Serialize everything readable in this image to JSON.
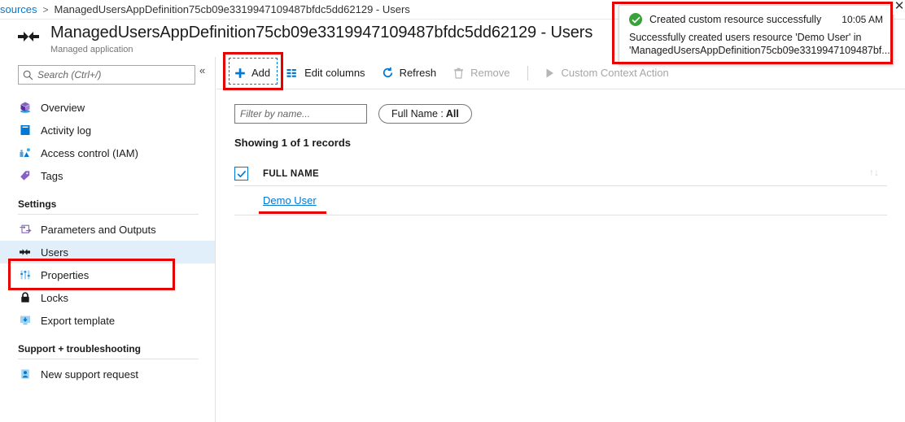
{
  "breadcrumb": {
    "root_label": "sources",
    "separator": ">",
    "current": "ManagedUsersAppDefinition75cb09e3319947109487bfdc5dd62129 - Users"
  },
  "header": {
    "title": "ManagedUsersAppDefinition75cb09e3319947109487bfdc5dd62129 - Users",
    "subtitle": "Managed application",
    "icon": "managed-application-icon"
  },
  "sidebar": {
    "search": {
      "placeholder": "Search (Ctrl+/)",
      "value": "",
      "icon": "search-icon"
    },
    "collapse": {
      "label": "«",
      "icon": "chevron-double-left-icon"
    },
    "items": [
      {
        "label": "Overview",
        "icon": "overview-icon",
        "selected": false
      },
      {
        "label": "Activity log",
        "icon": "activity-log-icon",
        "selected": false
      },
      {
        "label": "Access control (IAM)",
        "icon": "access-control-icon",
        "selected": false
      },
      {
        "label": "Tags",
        "icon": "tag-icon",
        "selected": false
      }
    ],
    "settings_section": {
      "title": "Settings",
      "items": [
        {
          "label": "Parameters and Outputs",
          "icon": "parameters-icon",
          "selected": false
        },
        {
          "label": "Users",
          "icon": "users-icon",
          "selected": true
        },
        {
          "label": "Properties",
          "icon": "properties-icon",
          "selected": false
        },
        {
          "label": "Locks",
          "icon": "lock-icon",
          "selected": false
        },
        {
          "label": "Export template",
          "icon": "export-template-icon",
          "selected": false
        }
      ]
    },
    "support_section": {
      "title": "Support + troubleshooting",
      "items": [
        {
          "label": "New support request",
          "icon": "support-request-icon",
          "selected": false
        }
      ]
    }
  },
  "toolbar": {
    "add_label": "Add",
    "add_icon": "plus-icon",
    "edit_columns_label": "Edit columns",
    "edit_columns_icon": "columns-icon",
    "refresh_label": "Refresh",
    "refresh_icon": "refresh-icon",
    "remove_label": "Remove",
    "remove_icon": "trash-icon",
    "custom_action_label": "Custom Context Action",
    "custom_action_icon": "play-icon"
  },
  "filters": {
    "name_filter_placeholder": "Filter by name...",
    "name_filter_value": "",
    "full_name_pill_label": "Full Name : ",
    "full_name_pill_value": "All"
  },
  "grid": {
    "records_text": "Showing 1 of 1 records",
    "select_all_checked": true,
    "columns": [
      "FULL NAME"
    ],
    "sort_icon": "sort-arrows-icon",
    "rows": [
      {
        "full_name": "Demo User"
      }
    ]
  },
  "notification": {
    "status_icon": "success-check-icon",
    "title": "Created custom resource successfully",
    "time": "10:05 AM",
    "message_line1": "Successfully created users resource 'Demo User' in",
    "message_line2": "'ManagedUsersAppDefinition75cb09e3319947109487bf...",
    "close_icon": "close-icon",
    "close_label": "✕"
  },
  "colors": {
    "accent": "#0078d4",
    "selected_row": "#e1effa",
    "success": "#3aa23a",
    "annotation": "#e60000",
    "disabled_text": "#a6a6a6"
  }
}
